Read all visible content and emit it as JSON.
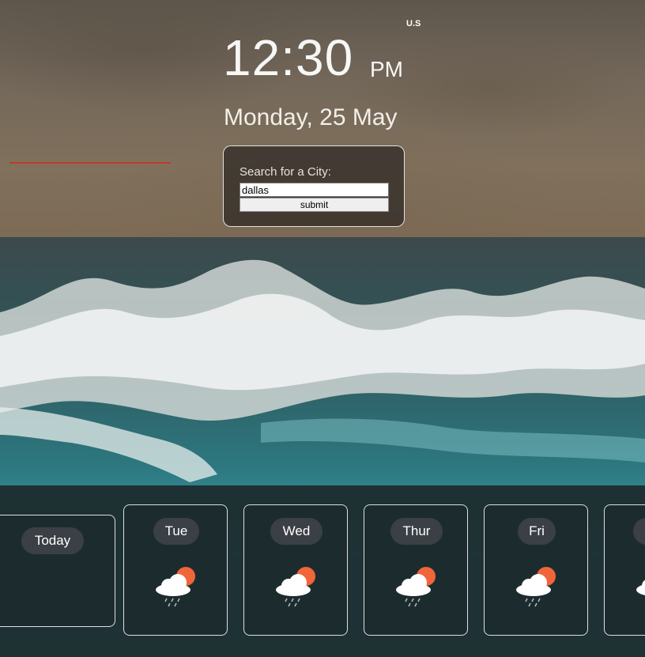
{
  "header": {
    "locale": "U.S"
  },
  "clock": {
    "time": "12:30",
    "ampm": "PM",
    "date": "Monday, 25 May"
  },
  "search": {
    "label": "Search for a City:",
    "value": "dallas",
    "submit_label": "submit"
  },
  "forecast": {
    "days": [
      {
        "label": "Today",
        "icon": "none"
      },
      {
        "label": "Tue",
        "icon": "rain-cloud-sun-icon"
      },
      {
        "label": "Wed",
        "icon": "rain-cloud-sun-icon"
      },
      {
        "label": "Thur",
        "icon": "rain-cloud-sun-icon"
      },
      {
        "label": "Fri",
        "icon": "rain-cloud-sun-icon"
      }
    ]
  },
  "colors": {
    "accent_line": "#c0392b",
    "sun": "#f0653a",
    "panel": "#1c2a2c"
  }
}
